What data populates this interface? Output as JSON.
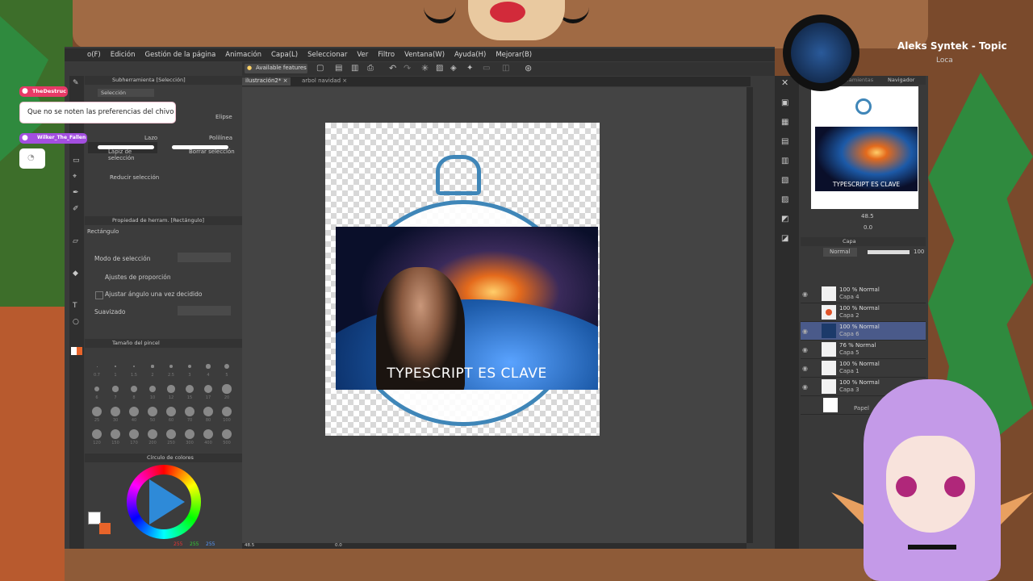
{
  "menu": [
    "o(F)",
    "Edición",
    "Gestión de la página",
    "Animación",
    "Capa(L)",
    "Seleccionar",
    "Ver",
    "Filtro",
    "Ventana(W)",
    "Ayuda(H)",
    "Mejorar(B)"
  ],
  "toolbar": {
    "available_features": "Available features"
  },
  "tabs": [
    "ilustración2*",
    "arbol navidad"
  ],
  "subtool": {
    "header": "Subherramienta [Selección]",
    "group": "Selección",
    "items": {
      "elipse": "Elipse",
      "lazo": "Lazo",
      "polilinea": "Polilínea",
      "lapiz": "Lápiz de selección",
      "borrar": "Borrar selección",
      "reducir": "Reducir selección"
    }
  },
  "tool_property": {
    "header": "Propiedad de herram. [Rectángulo]",
    "name": "Rectángulo",
    "mode": "Modo de selección",
    "proportion": "Ajustes de proporción",
    "angle": "Ajustar ángulo una vez decidido",
    "smoothing": "Suavizado"
  },
  "brush_size": {
    "header": "Tamaño del pincel",
    "sizes": [
      "0.7",
      "1",
      "1.5",
      "2",
      "2.5",
      "3",
      "4",
      "5",
      "6",
      "7",
      "8",
      "10",
      "12",
      "15",
      "17",
      "20",
      "25",
      "30",
      "40",
      "50",
      "60",
      "70",
      "80",
      "100",
      "120",
      "150",
      "170",
      "200",
      "250",
      "300",
      "400",
      "500"
    ]
  },
  "color_wheel": {
    "header": "Círculo de colores",
    "rgb": [
      "255",
      "255",
      "255"
    ]
  },
  "canvas": {
    "caption": "TYPESCRIPT ES CLAVE",
    "zoom": "48.5",
    "angle": "0.0"
  },
  "navigator": {
    "tab1": "Caja de herramientas",
    "tab2": "Navigador",
    "zoom": "48.5",
    "angle": "0.0",
    "caption": "TYPESCRIPT ES CLAVE"
  },
  "layers": {
    "header": "Capa",
    "blend": "Normal",
    "opacity": "100",
    "items": [
      {
        "pct": "100 % Normal",
        "name": "Capa 4"
      },
      {
        "pct": "100 % Normal",
        "name": "Capa 2"
      },
      {
        "pct": "100 % Normal",
        "name": "Capa 6"
      },
      {
        "pct": "76 % Normal",
        "name": "Capa 5"
      },
      {
        "pct": "100 % Normal",
        "name": "Capa 1"
      },
      {
        "pct": "100 % Normal",
        "name": "Capa 3"
      },
      {
        "pct": "",
        "name": "Papel"
      }
    ]
  },
  "chat": [
    {
      "user": "TheDestruc",
      "message": "Que no se noten las preferencias del chivo"
    },
    {
      "user": "Wilker_The_Fallen",
      "message": ""
    }
  ],
  "music": {
    "artist": "Aleks Syntek - Topic",
    "song": "Loca"
  },
  "colors": {
    "chat_pink": "#e83a67",
    "chat_purple": "#a34ee0",
    "accent_blue": "#4a5a8a"
  }
}
